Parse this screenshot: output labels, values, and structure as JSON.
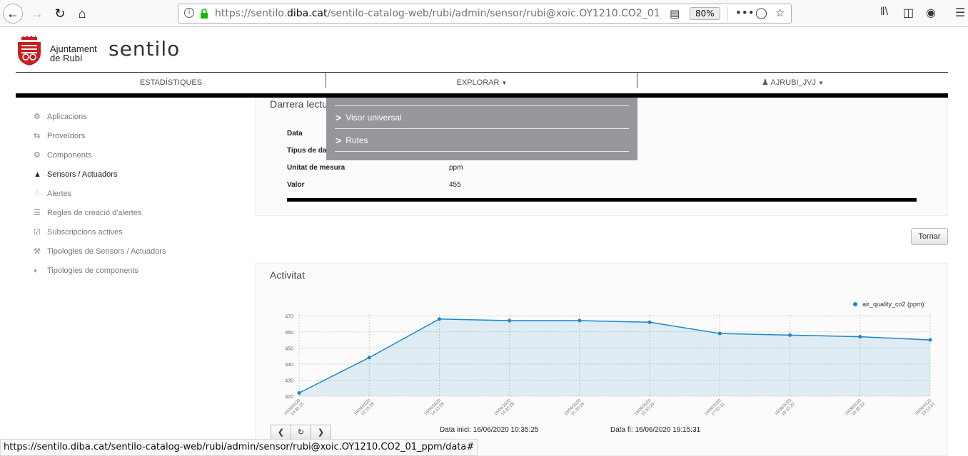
{
  "browser": {
    "url_prefix": "https://sentilo.",
    "url_domain": "diba.cat",
    "url_rest": "/sentilo-catalog-web/rubi/admin/sensor/rubi@xoic.OY1210.CO2_01_ppm/data",
    "zoom": "80%",
    "status_url": "https://sentilo.diba.cat/sentilo-catalog-web/rubi/admin/sensor/rubi@xoic.OY1210.CO2_01_ppm/data#"
  },
  "header": {
    "org_line1": "Ajuntament",
    "org_line2": "de Rubí",
    "brand": "sentilo"
  },
  "topnav": {
    "stats": "ESTADÍSTIQUES",
    "explore": "EXPLORAR",
    "user": "AJRUBI_JVJ"
  },
  "dropdown": {
    "items": [
      "Visor universal",
      "Rutes"
    ]
  },
  "sidebar": {
    "items": [
      {
        "label": "Aplicacions",
        "icon": "gear-icon"
      },
      {
        "label": "Proveïdors",
        "icon": "exchange-icon"
      },
      {
        "label": "Components",
        "icon": "cogs-icon"
      },
      {
        "label": "Sensors / Actuadors",
        "icon": "flask-icon"
      },
      {
        "label": "Alertes",
        "icon": "bell-icon"
      },
      {
        "label": "Regles de creació d'alertes",
        "icon": "list-icon"
      },
      {
        "label": "Subscripcions actives",
        "icon": "check-icon"
      },
      {
        "label": "Tipologies de Sensors / Actuadors",
        "icon": "wrench-icon"
      },
      {
        "label": "Tipologies de components",
        "icon": "half-circle-icon"
      }
    ]
  },
  "lecture": {
    "title": "Darrera lectu",
    "fields": [
      {
        "label": "Data",
        "value": ""
      },
      {
        "label": "Tipus de da",
        "value": ""
      },
      {
        "label": "Unitat de mesura",
        "value": "ppm"
      },
      {
        "label": "Valor",
        "value": "455"
      }
    ]
  },
  "tornar_label": "Tornar",
  "activity": {
    "title": "Activitat",
    "range_start": "Data inici: 16/06/2020 10:35:25",
    "range_end": "Data fi: 16/06/2020 19:15:31"
  },
  "chart_data": {
    "type": "area",
    "x": [
      "16/06/2020 10:35:25",
      "16/06/2020 13:15:28",
      "16/06/2020 14:15:28",
      "16/06/2020 14:35:28",
      "16/06/2020 15:35:29",
      "16/06/2020 15:55:29",
      "16/06/2020 17:55:31",
      "16/06/2020 18:15:32",
      "16/06/2020 18:35:32",
      "16/06/2020 19:15:31"
    ],
    "x_top": [
      "16/06/2020",
      "16/06/2020",
      "16/06/2020",
      "16/06/2020",
      "16/06/2020",
      "16/06/2020",
      "16/06/2020",
      "16/06/2020",
      "16/06/2020",
      "16/06/2020"
    ],
    "x_bottom": [
      "10:35:25",
      "13:15:28",
      "14:15:28",
      "14:35:28",
      "15:35:29",
      "15:55:29",
      "17:55:31",
      "18:15:32",
      "18:35:32",
      "19:15:31"
    ],
    "series": [
      {
        "name": "air_quality_co2 (ppm)",
        "values": [
          422,
          444,
          468,
          467,
          467,
          466,
          459,
          458,
          457,
          455
        ]
      }
    ],
    "yticks": [
      420,
      430,
      440,
      450,
      460,
      470
    ],
    "ylim": [
      420,
      471
    ],
    "grid": true,
    "legend": "top-right",
    "color": "#1a87c9"
  }
}
